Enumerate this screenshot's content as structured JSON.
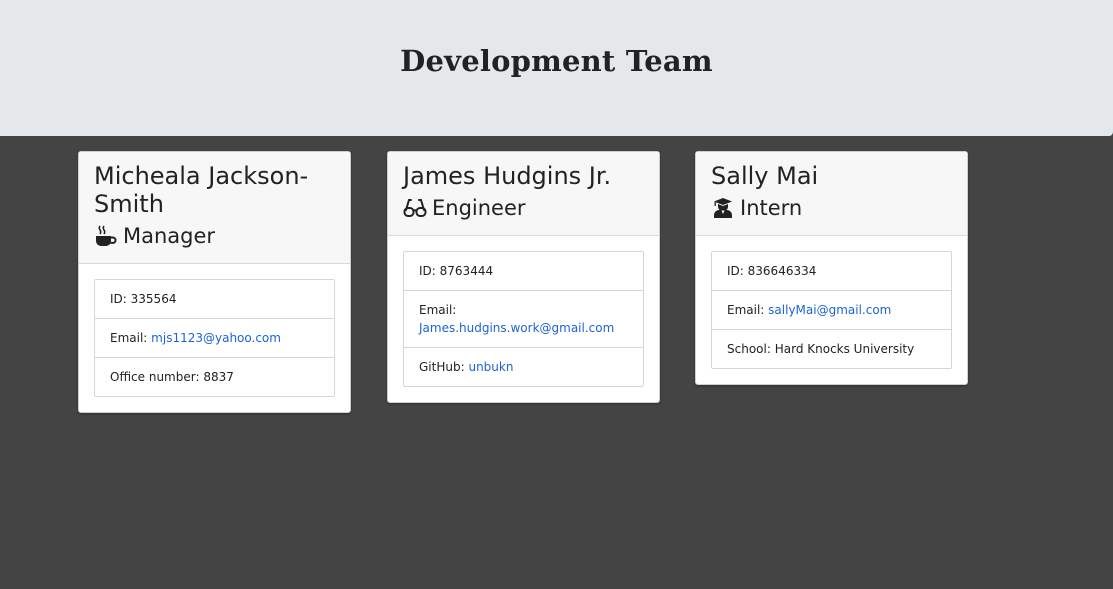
{
  "header": {
    "title": "Development Team"
  },
  "cards": [
    {
      "name": "Micheala Jackson-Smith",
      "role": "Manager",
      "role_icon": "coffee-mug-icon",
      "id_label": "ID:",
      "id": "335564",
      "email_label": "Email:",
      "email": "mjs1123@yahoo.com",
      "extra_label": "Office number:",
      "extra_value": "8837"
    },
    {
      "name": "James Hudgins Jr.",
      "role": "Engineer",
      "role_icon": "glasses-icon",
      "id_label": "ID:",
      "id": "8763444",
      "email_label": "Email:",
      "email": "James.hudgins.work@gmail.com",
      "extra_label": "GitHub:",
      "extra_value": "unbukn"
    },
    {
      "name": "Sally Mai",
      "role": "Intern",
      "role_icon": "graduate-icon",
      "id_label": "ID:",
      "id": "836646334",
      "email_label": "Email:",
      "email": "sallyMai@gmail.com",
      "extra_label": "School:",
      "extra_value": "Hard Knocks University"
    }
  ],
  "colors": {
    "page_background": "#444444",
    "header_background": "#e5e8eb",
    "link": "#1e63d6"
  }
}
